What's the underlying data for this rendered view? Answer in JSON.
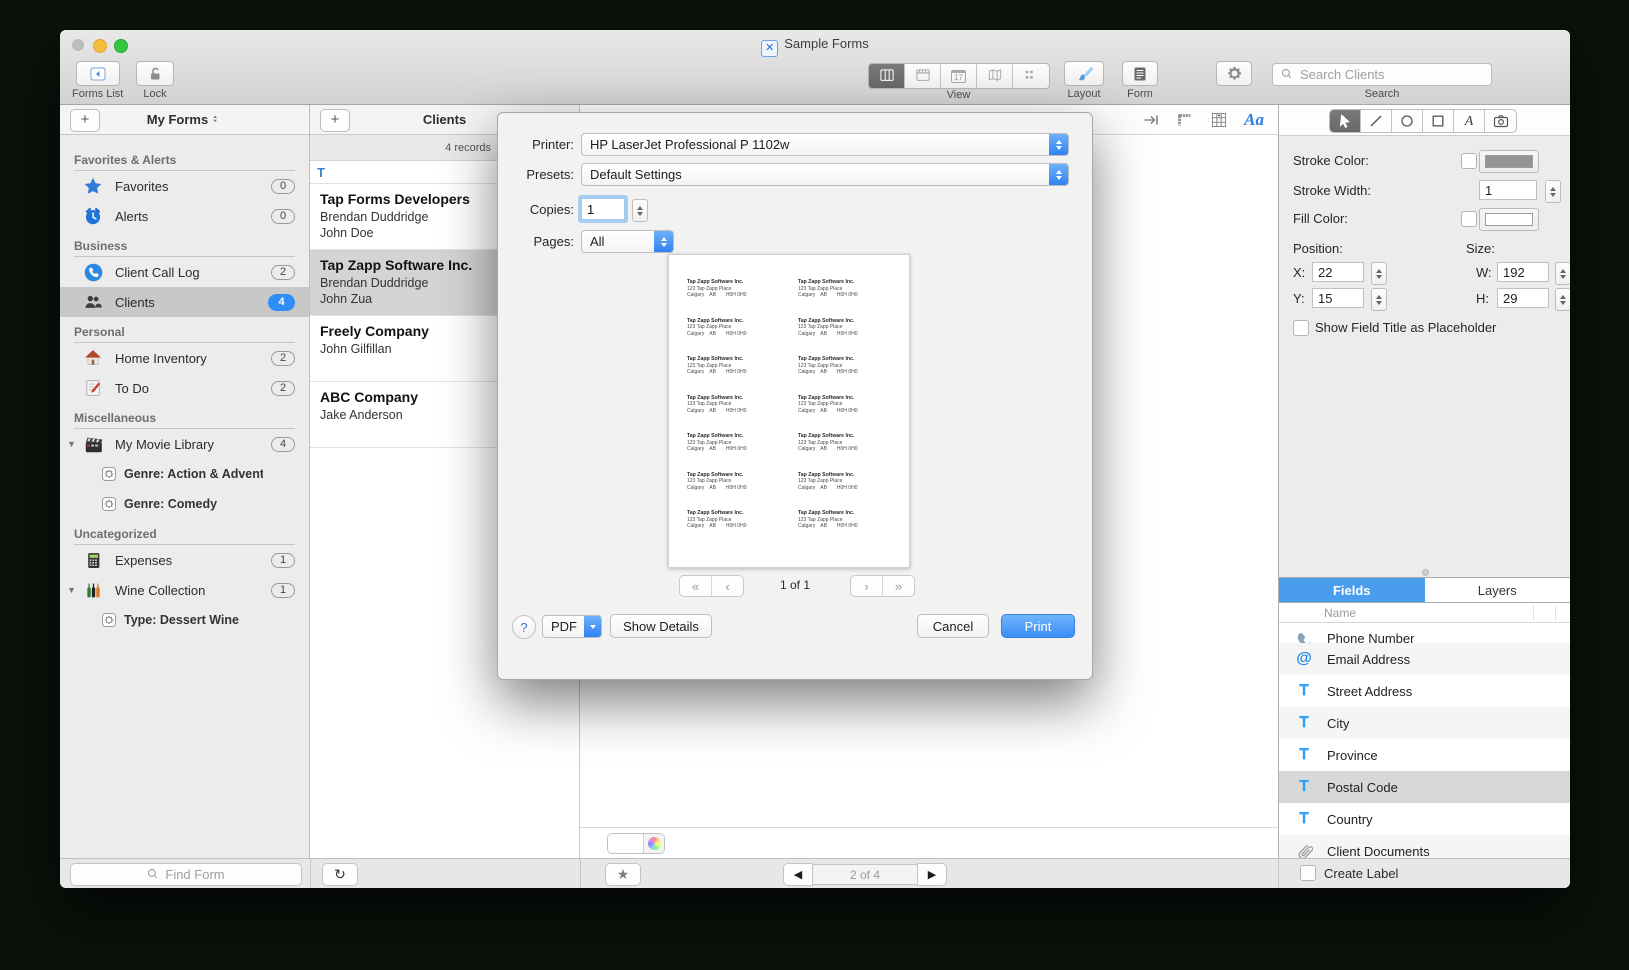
{
  "window": {
    "title": "Sample Forms"
  },
  "toolbar": {
    "forms_list_label": "Forms List",
    "lock_label": "Lock",
    "view_label": "View",
    "calendar_number": "17",
    "layout_label": "Layout",
    "form_label": "Form",
    "search_label": "Search",
    "search_placeholder": "Search Clients",
    "aa_glyph": "Aa"
  },
  "sidebar": {
    "add_button": "+",
    "header": "My Forms",
    "sections": [
      {
        "title": "Favorites & Alerts",
        "items": [
          {
            "icon": "star",
            "label": "Favorites",
            "count": "0"
          },
          {
            "icon": "alarm",
            "label": "Alerts",
            "count": "0"
          }
        ]
      },
      {
        "title": "Business",
        "items": [
          {
            "icon": "phone",
            "label": "Client Call Log",
            "count": "2"
          },
          {
            "icon": "people",
            "label": "Clients",
            "count": "4",
            "selected": true
          }
        ]
      },
      {
        "title": "Personal",
        "items": [
          {
            "icon": "house",
            "label": "Home Inventory",
            "count": "2"
          },
          {
            "icon": "todo",
            "label": "To Do",
            "count": "2"
          }
        ]
      },
      {
        "title": "Miscellaneous",
        "items": [
          {
            "icon": "movie",
            "label": "My Movie Library",
            "count": "4",
            "expanded": true
          },
          {
            "icon": "gearbox",
            "label": "Genre: Action & Adventure",
            "child": true
          },
          {
            "icon": "gearbox",
            "label": "Genre: Comedy",
            "child": true
          }
        ]
      },
      {
        "title": "Uncategorized",
        "items": [
          {
            "icon": "calculator",
            "label": "Expenses",
            "count": "1"
          },
          {
            "icon": "wine",
            "label": "Wine Collection",
            "count": "1",
            "expanded": true
          },
          {
            "icon": "gearbox",
            "label": "Type: Dessert Wine",
            "child": true
          }
        ]
      }
    ],
    "find_placeholder": "Find Form"
  },
  "clients": {
    "add_button": "+",
    "header": "Clients",
    "records_count": "4 records",
    "group_letter": "T",
    "records": [
      {
        "name": "Tap Forms Developers",
        "lines": [
          "Brendan Duddridge",
          "John Doe"
        ]
      },
      {
        "name": "Tap Zapp Software Inc.",
        "lines": [
          "Brendan Duddridge",
          "John Zua"
        ],
        "selected": true
      },
      {
        "name": "Freely Company",
        "lines": [
          "John Gilfillan"
        ]
      },
      {
        "name": "ABC Company",
        "lines": [
          "Jake Anderson"
        ]
      }
    ]
  },
  "print_dialog": {
    "printer_label": "Printer:",
    "printer_value": "HP LaserJet Professional P 1102w",
    "presets_label": "Presets:",
    "presets_value": "Default Settings",
    "copies_label": "Copies:",
    "copies_value": "1",
    "pages_label": "Pages:",
    "pages_value": "All",
    "preview": {
      "rows": 7,
      "columns": 2,
      "label_line1": "Tap Zapp Software Inc.",
      "label_line2": "123 Tap Zapp Place",
      "label_city": "Calgary",
      "label_province": "AB",
      "label_postal": "H0H 0H0"
    },
    "page_indicator": "1 of 1",
    "help_label": "?",
    "pdf_label": "PDF",
    "show_details_label": "Show Details",
    "cancel_label": "Cancel",
    "print_label": "Print"
  },
  "inspector": {
    "stroke_color_label": "Stroke Color:",
    "stroke_width_label": "Stroke Width:",
    "stroke_width_value": "1",
    "fill_color_label": "Fill Color:",
    "position_label": "Position:",
    "size_label": "Size:",
    "x_label": "X:",
    "x_value": "22",
    "y_label": "Y:",
    "y_value": "15",
    "w_label": "W:",
    "w_value": "192",
    "h_label": "H:",
    "h_value": "29",
    "placeholder_checkbox_label": "Show Field Title as Placeholder"
  },
  "fields_panel": {
    "tabs": {
      "fields": "Fields",
      "layers": "Layers"
    },
    "name_header": "Name",
    "items": [
      {
        "icon": "phonefield",
        "label": "Phone Number",
        "clip": "top"
      },
      {
        "icon": "at",
        "label": "Email Address",
        "stripe": true
      },
      {
        "icon": "text",
        "label": "Street Address"
      },
      {
        "icon": "text",
        "label": "City",
        "stripe": true
      },
      {
        "icon": "text",
        "label": "Province"
      },
      {
        "icon": "text",
        "label": "Postal Code",
        "selected": true
      },
      {
        "icon": "text",
        "label": "Country"
      },
      {
        "icon": "attachment",
        "label": "Client Documents",
        "clip": "bottom",
        "stripe": true
      }
    ],
    "create_label": "Create Label"
  },
  "bottom_bar": {
    "record_nav": "2 of 4"
  }
}
